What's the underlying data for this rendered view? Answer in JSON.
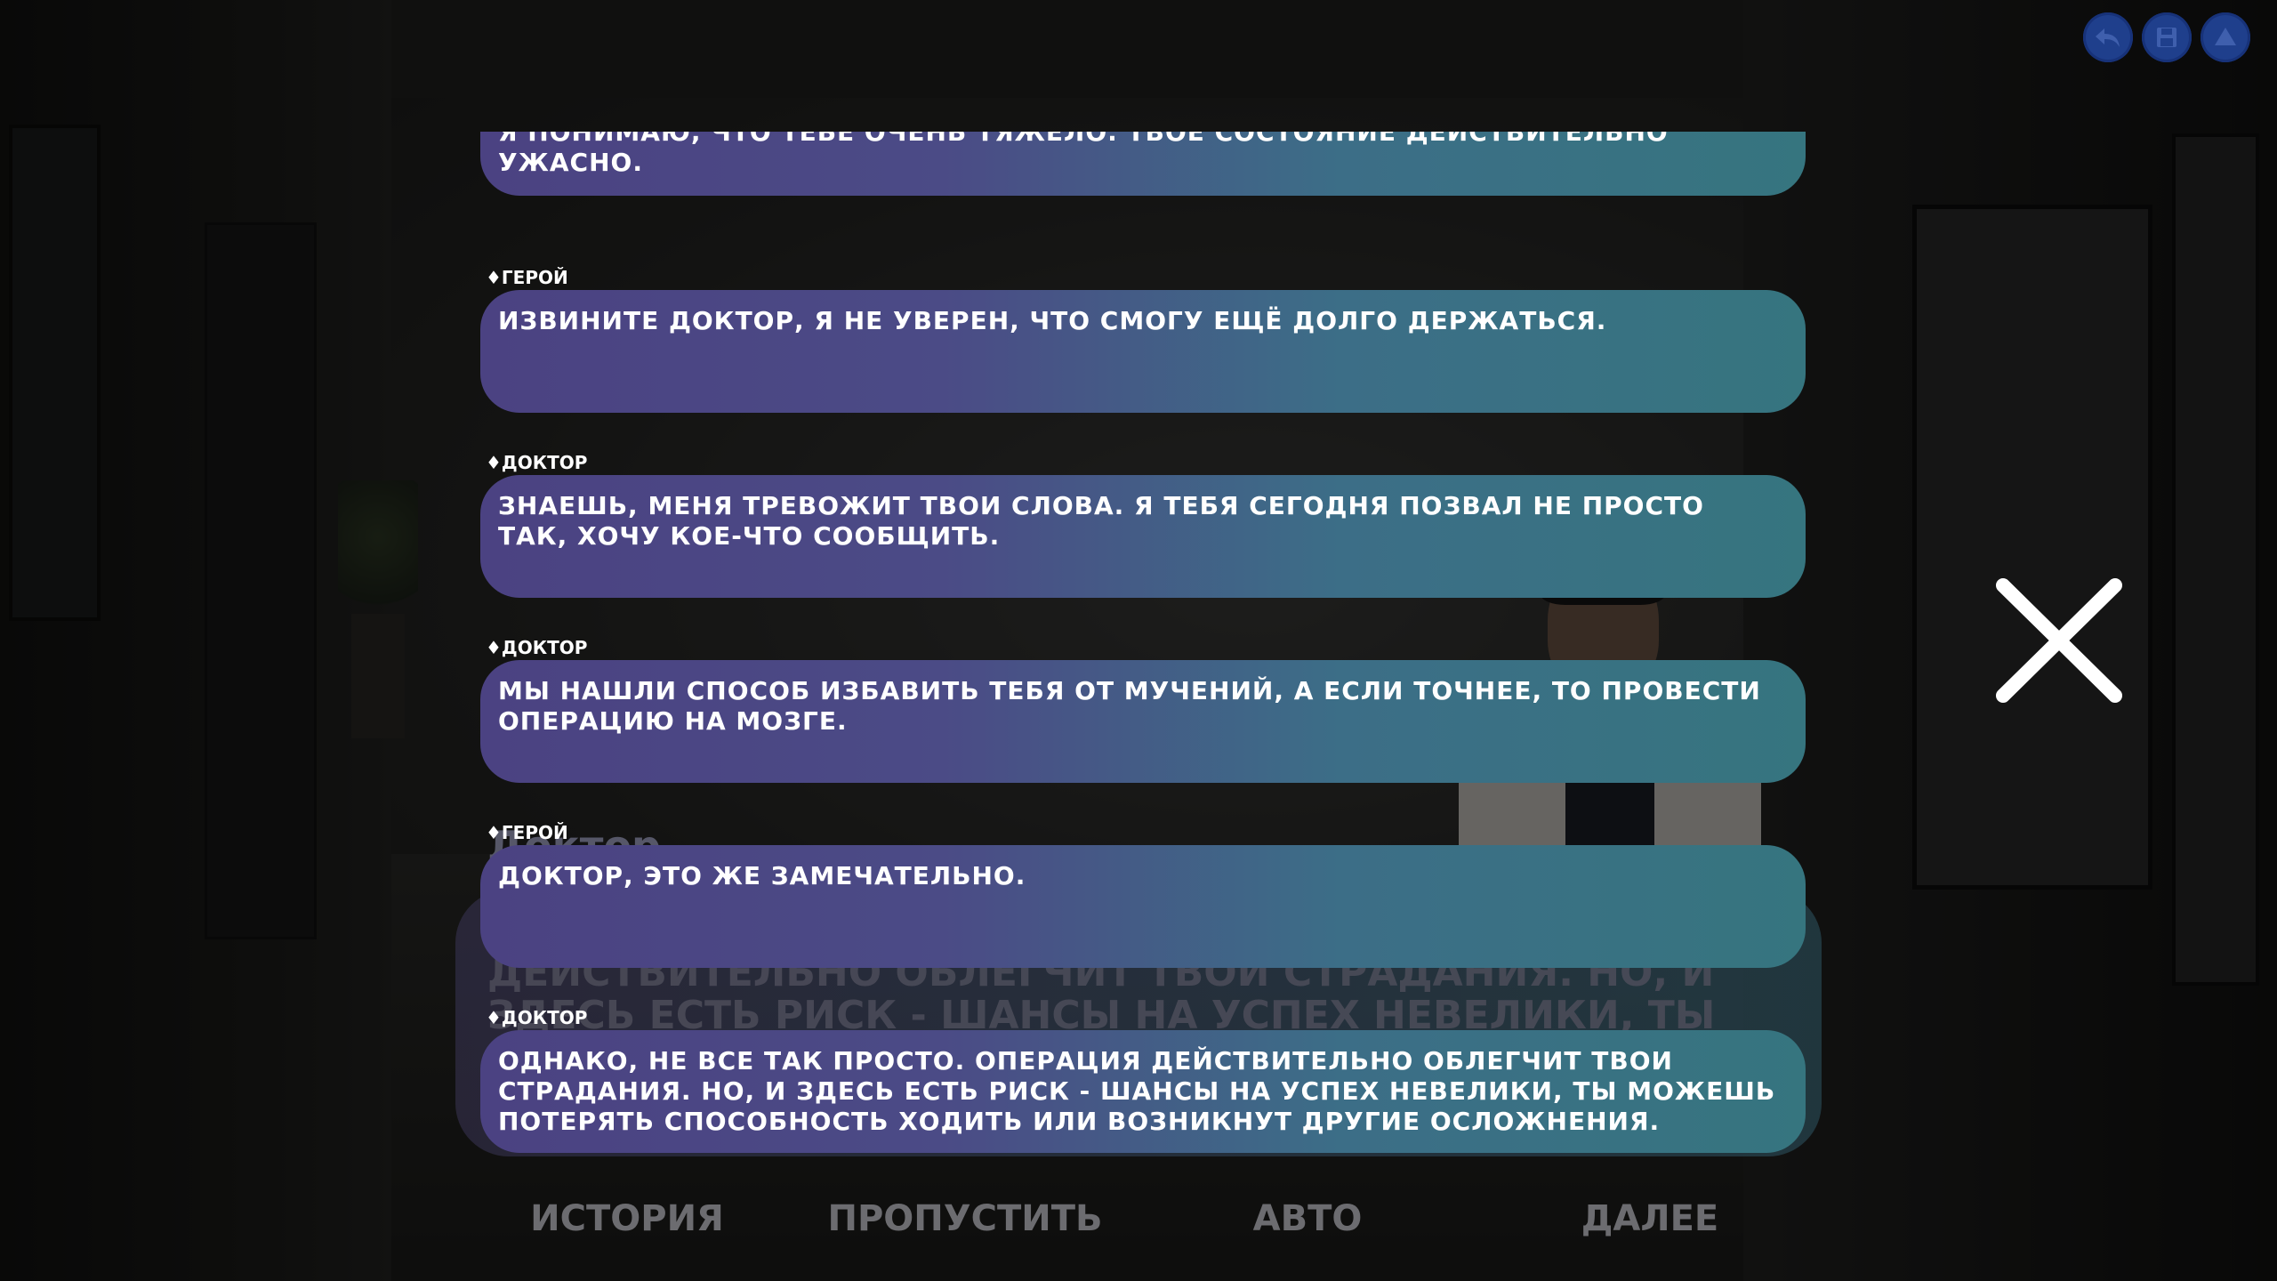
{
  "history": [
    {
      "speaker": "",
      "text": "Я понимаю, что тебе очень тяжело. Твоё состояние действительно ужасно."
    },
    {
      "speaker": "♦Герой",
      "text": "Извините доктор, я не уверен, что смогу ещё долго держаться."
    },
    {
      "speaker": "♦Доктор",
      "text": "Знаешь, меня тревожит твои слова. Я тебя сегодня позвал не просто так, хочу кое-что сообщить."
    },
    {
      "speaker": "♦Доктор",
      "text": "Мы нашли способ избавить тебя от мучений, а если точнее, то провести операцию на мозге."
    },
    {
      "speaker": "♦Герой",
      "text": "Доктор, это же замечательно."
    },
    {
      "speaker": "♦Доктор",
      "text": "Однако, не все так просто. Операция действительно облегчит твои страдания. Но, и здесь есть риск - шансы на успех невелики, ты можешь потерять способность ходить или возникнут другие осложнения."
    }
  ],
  "dialogue": {
    "name": "Доктор",
    "text": "Однако, не все так просто. Операция действительно облегчит твои страдания. Но, и здесь есть риск - шансы на успех невелики, ты можешь потерять способность ходить"
  },
  "quick_menu": {
    "history": "ИСТОРИЯ",
    "skip": "ПРОПУСТИТЬ",
    "auto": "АВТО",
    "next": "ДАЛЕЕ"
  },
  "top_buttons": {
    "back_icon": "undo-arrow-icon",
    "save_icon": "floppy-disk-icon",
    "menu_icon": "triangle-up-icon",
    "color": "#1f3f8c"
  },
  "colors": {
    "bubble_start": "#4b4282",
    "bubble_end": "#36757f",
    "quick_text": "#6c6c70"
  }
}
